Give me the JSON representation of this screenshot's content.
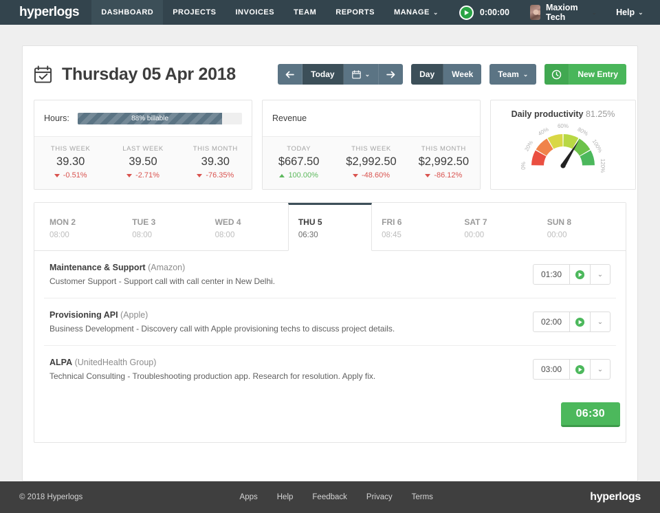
{
  "brand": "hyperlogs",
  "topnav": {
    "items": [
      {
        "label": "DASHBOARD",
        "active": true,
        "caret": false
      },
      {
        "label": "PROJECTS",
        "active": false,
        "caret": false
      },
      {
        "label": "INVOICES",
        "active": false,
        "caret": false
      },
      {
        "label": "TEAM",
        "active": false,
        "caret": false
      },
      {
        "label": "REPORTS",
        "active": false,
        "caret": false
      },
      {
        "label": "MANAGE",
        "active": false,
        "caret": true
      }
    ],
    "timer": "0:00:00",
    "user": "Maxiom Tech",
    "help": "Help",
    "caret_glyph": "⌄",
    "bell_icon": "bell-icon",
    "play_icon": "play-icon"
  },
  "header": {
    "title": "Thursday 05 Apr 2018",
    "calendar_icon": "calendar-icon",
    "prev_label": "←",
    "today_label": "Today",
    "next_label": "→",
    "datepicker_icon": "calendar-picker-icon",
    "day_label": "Day",
    "week_label": "Week",
    "team_label": "Team",
    "new_entry_label": "New Entry",
    "new_entry_icon": "clock-icon"
  },
  "cards": {
    "hours": {
      "label": "Hours:",
      "progress_text": "88% billable",
      "progress_pct": 88,
      "stats": [
        {
          "label": "THIS WEEK",
          "value": "39.30",
          "delta": "-0.51%",
          "dir": "down"
        },
        {
          "label": "LAST WEEK",
          "value": "39.50",
          "delta": "-2.71%",
          "dir": "down"
        },
        {
          "label": "THIS MONTH",
          "value": "39.30",
          "delta": "-76.35%",
          "dir": "down"
        }
      ]
    },
    "revenue": {
      "label": "Revenue",
      "stats": [
        {
          "label": "TODAY",
          "value": "$667.50",
          "delta": "100.00%",
          "dir": "up"
        },
        {
          "label": "THIS WEEK",
          "value": "$2,992.50",
          "delta": "-48.60%",
          "dir": "down"
        },
        {
          "label": "THIS MONTH",
          "value": "$2,992.50",
          "delta": "-86.12%",
          "dir": "down"
        }
      ]
    },
    "productivity": {
      "title": "Daily productivity",
      "value": "81.25%",
      "gauge": {
        "min": 0,
        "max": 120,
        "needle_value": 81.25,
        "tick_labels": [
          "0%",
          "20%",
          "40%",
          "60%",
          "80%",
          "100%",
          "120%"
        ],
        "segments": [
          {
            "from": 0,
            "to": 20,
            "color": "#ea4f41"
          },
          {
            "from": 20,
            "to": 40,
            "color": "#f0834a"
          },
          {
            "from": 40,
            "to": 60,
            "color": "#d9d744"
          },
          {
            "from": 60,
            "to": 80,
            "color": "#b8d844"
          },
          {
            "from": 80,
            "to": 100,
            "color": "#6cc24a"
          },
          {
            "from": 100,
            "to": 120,
            "color": "#4cb85c"
          }
        ]
      }
    }
  },
  "week": {
    "days": [
      {
        "name": "MON 2",
        "time": "08:00",
        "active": false
      },
      {
        "name": "TUE 3",
        "time": "08:00",
        "active": false
      },
      {
        "name": "WED 4",
        "time": "08:00",
        "active": false
      },
      {
        "name": "THU 5",
        "time": "06:30",
        "active": true
      },
      {
        "name": "FRI 6",
        "time": "08:45",
        "active": false
      },
      {
        "name": "SAT 7",
        "time": "00:00",
        "active": false
      },
      {
        "name": "SUN 8",
        "time": "00:00",
        "active": false
      }
    ]
  },
  "entries": [
    {
      "project": "Maintenance & Support",
      "client": "(Amazon)",
      "description": "Customer Support - Support call with call center in New Delhi.",
      "duration": "01:30",
      "play_icon": "play-icon",
      "more_icon": "chevron-down-icon"
    },
    {
      "project": "Provisioning API",
      "client": "(Apple)",
      "description": "Business Development - Discovery call with Apple provisioning techs to discuss project details.",
      "duration": "02:00",
      "play_icon": "play-icon",
      "more_icon": "chevron-down-icon"
    },
    {
      "project": "ALPA",
      "client": "(UnitedHealth Group)",
      "description": "Technical Consulting - Troubleshooting production app. Research for resolution. Apply fix.",
      "duration": "03:00",
      "play_icon": "play-icon",
      "more_icon": "chevron-down-icon"
    }
  ],
  "total": "06:30",
  "footer": {
    "copyright": "© 2018 Hyperlogs",
    "links": [
      "Apps",
      "Help",
      "Feedback",
      "Privacy",
      "Terms"
    ],
    "brand": "hyperlogs"
  }
}
